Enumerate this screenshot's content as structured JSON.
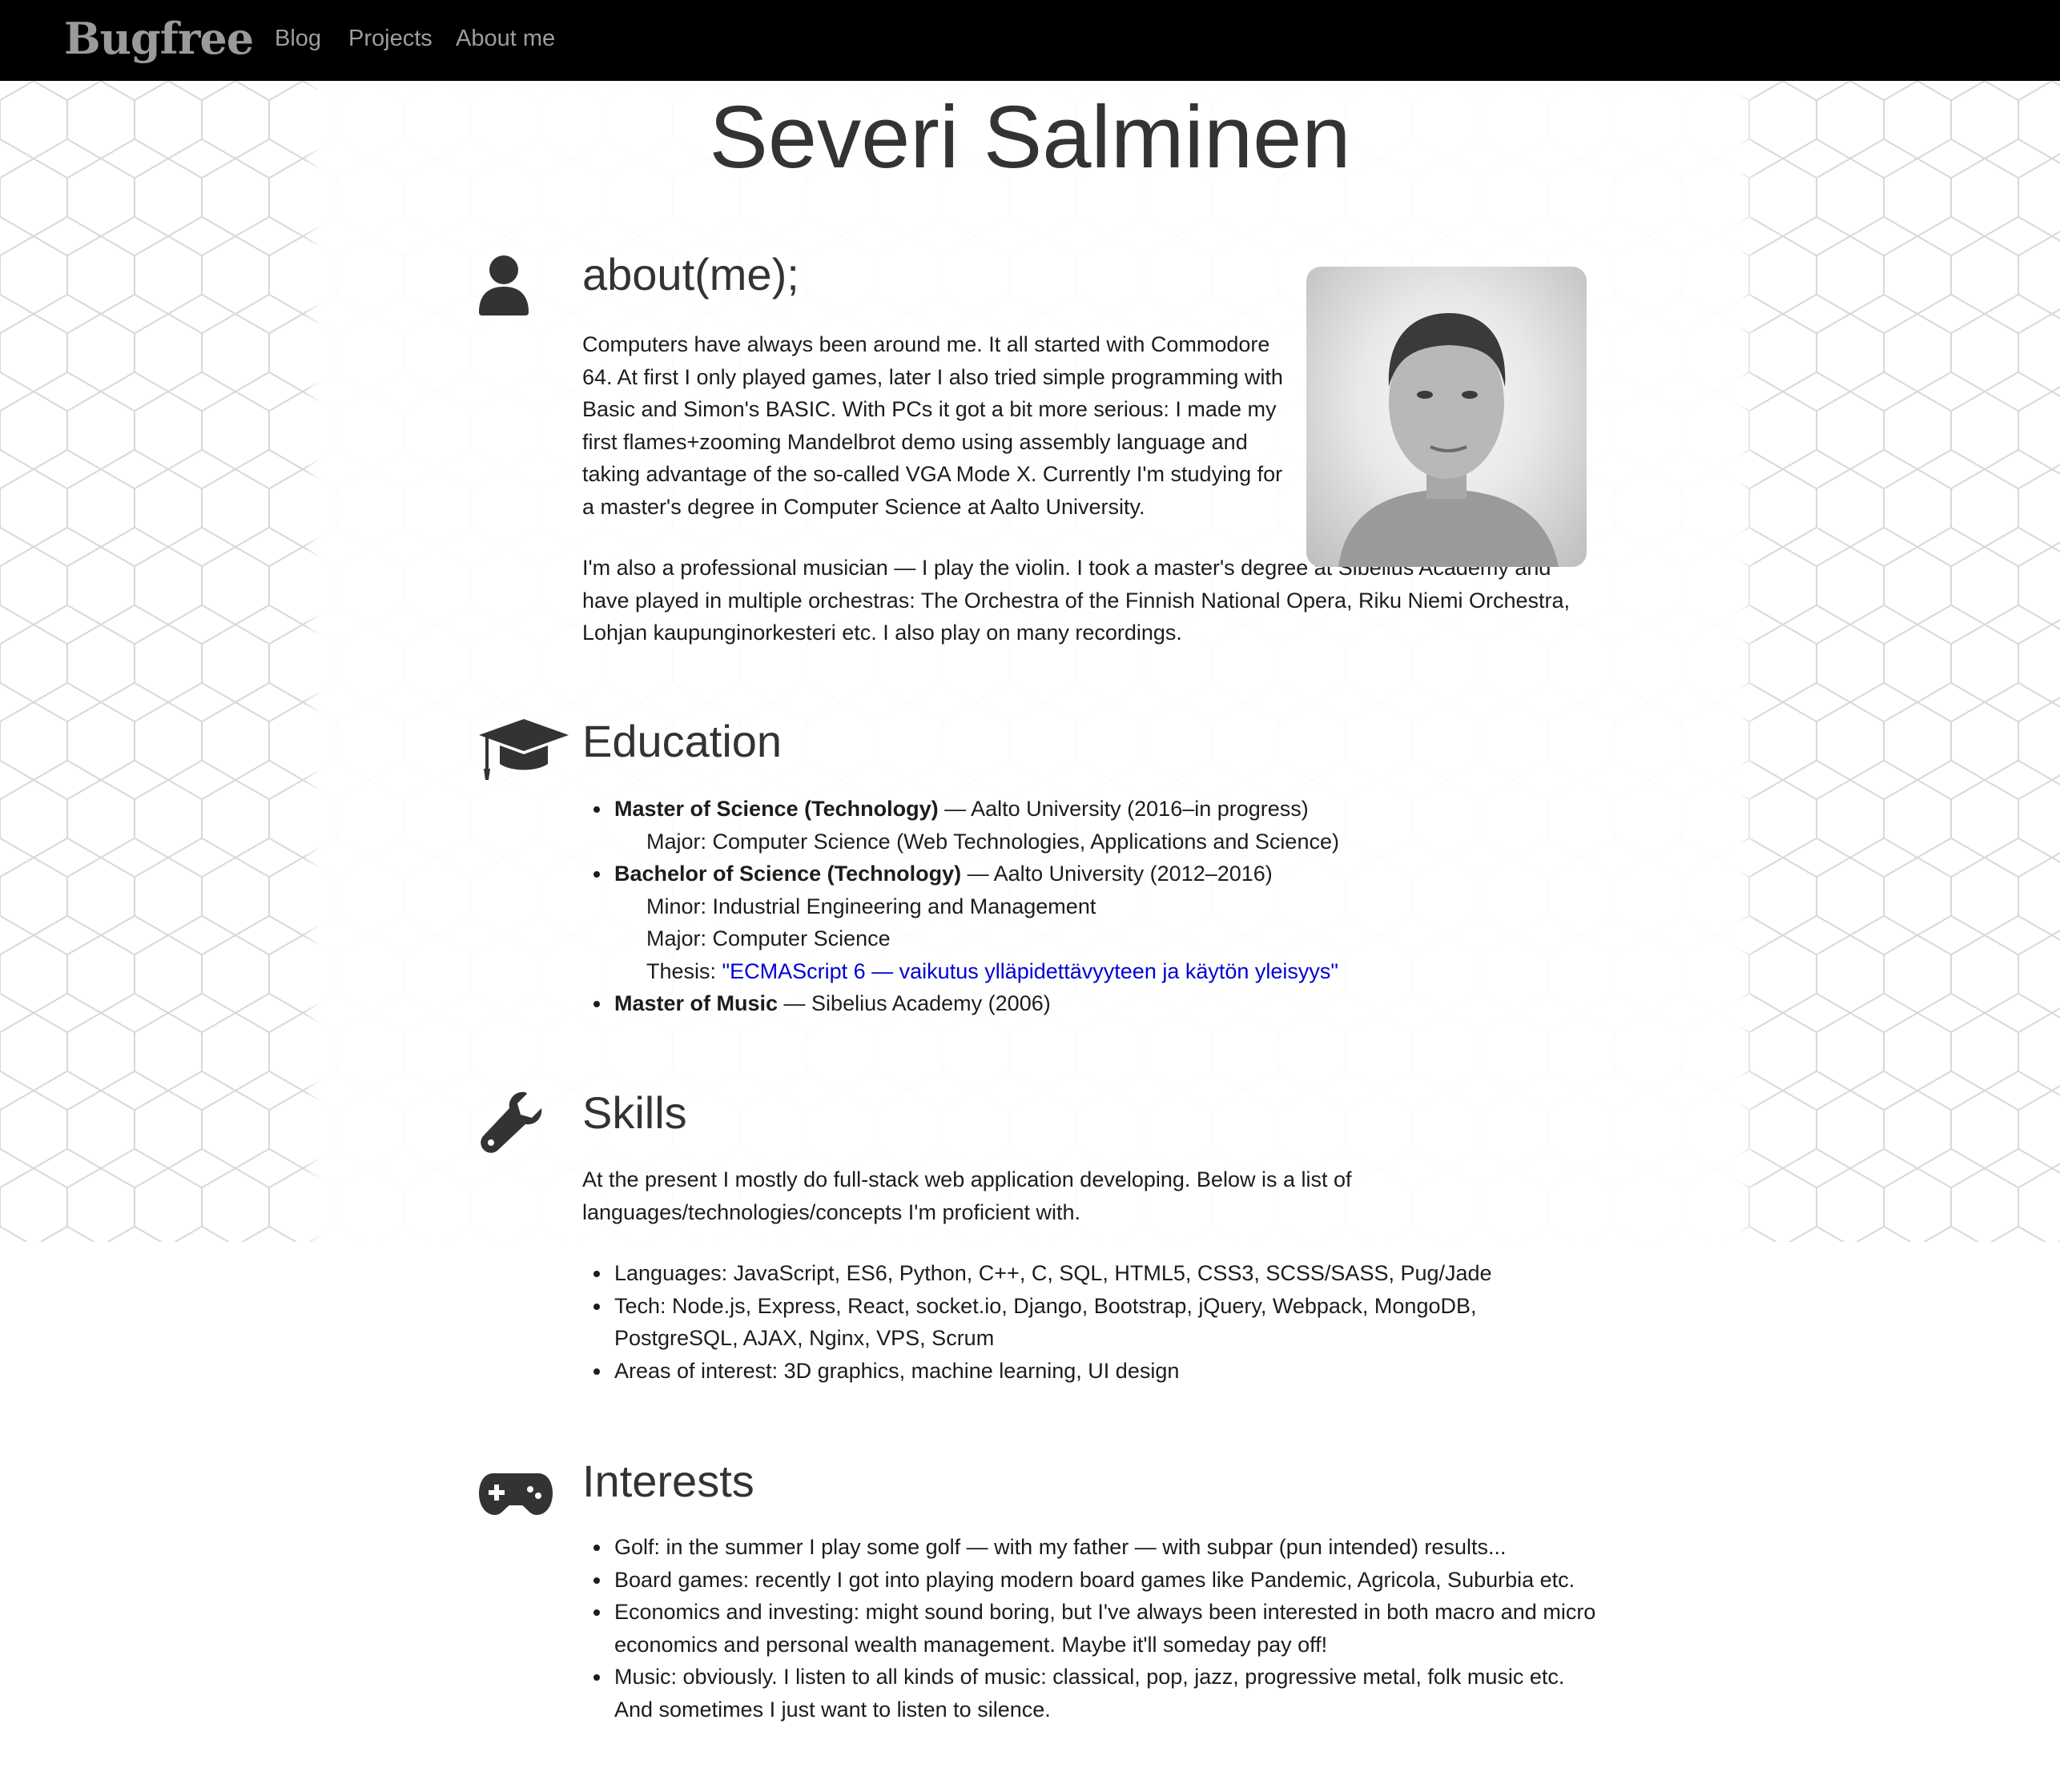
{
  "nav": {
    "brand": "Bugfree",
    "links": [
      "Blog",
      "Projects",
      "About me"
    ]
  },
  "page": {
    "title": "Severi Salminen"
  },
  "about": {
    "heading": "about(me);",
    "icon": "user-icon",
    "p1": "Computers have always been around me. It all started with Commodore 64. At first I only played games, later I also tried simple programming with Basic and Simon's BASIC. With PCs it got a bit more serious: I made my first flames+zooming Mandelbrot demo using assembly language and taking advantage of the so-called VGA Mode X. Currently I'm studying for a master's degree in Computer Science at Aalto University.",
    "p2": "I'm also a professional musician — I play the violin. I took a master's degree at Sibelius Academy and have played in multiple orchestras: The Orchestra of the Finnish National Opera, Riku Niemi Orchestra, Lohjan kaupunginorkesteri etc. I also play on many recordings.",
    "photo_name": "profile-photo"
  },
  "education": {
    "heading": "Education",
    "icon": "graduation-cap-icon",
    "items": [
      {
        "degree": "Master of Science (Technology)",
        "rest": " — Aalto University (2016–in progress)",
        "sub": [
          "Major: Computer Science (Web Technologies, Applications and Science)"
        ]
      },
      {
        "degree": "Bachelor of Science (Technology)",
        "rest": " — Aalto University (2012–2016)",
        "sub": [
          "Minor: Industrial Engineering and Management",
          "Major: Computer Science"
        ],
        "thesis_label": "Thesis: ",
        "thesis_link": "\"ECMAScript 6 — vaikutus ylläpidettävyyteen ja käytön yleisyys\""
      },
      {
        "degree": "Master of Music",
        "rest": " — Sibelius Academy (2006)"
      }
    ]
  },
  "skills": {
    "heading": "Skills",
    "icon": "wrench-icon",
    "intro": "At the present I mostly do full-stack web application developing. Below is a list of languages/technologies/concepts I'm proficient with.",
    "items": [
      "Languages: JavaScript, ES6, Python, C++, C, SQL, HTML5, CSS3, SCSS/SASS, Pug/Jade",
      "Tech: Node.js, Express, React, socket.io, Django, Bootstrap, jQuery, Webpack, MongoDB, PostgreSQL, AJAX, Nginx, VPS, Scrum",
      "Areas of interest: 3D graphics, machine learning, UI design"
    ]
  },
  "interests": {
    "heading": "Interests",
    "icon": "gamepad-icon",
    "items": [
      "Golf: in the summer I play some golf — with my father — with subpar (pun intended) results...",
      "Board games: recently I got into playing modern board games like Pandemic, Agricola, Suburbia etc.",
      "Economics and investing: might sound boring, but I've always been interested in both macro and micro economics and personal wealth management. Maybe it'll someday pay off!",
      "Music: obviously. I listen to all kinds of music: classical, pop, jazz, progressive metal, folk music etc. And sometimes I just want to listen to silence."
    ]
  },
  "colors": {
    "navbar": "#000000",
    "brand": "#9a9a9a",
    "nav_link": "#9d9d9d",
    "heading": "#333333",
    "text": "#1c1c1c",
    "link": "#0000d6"
  }
}
